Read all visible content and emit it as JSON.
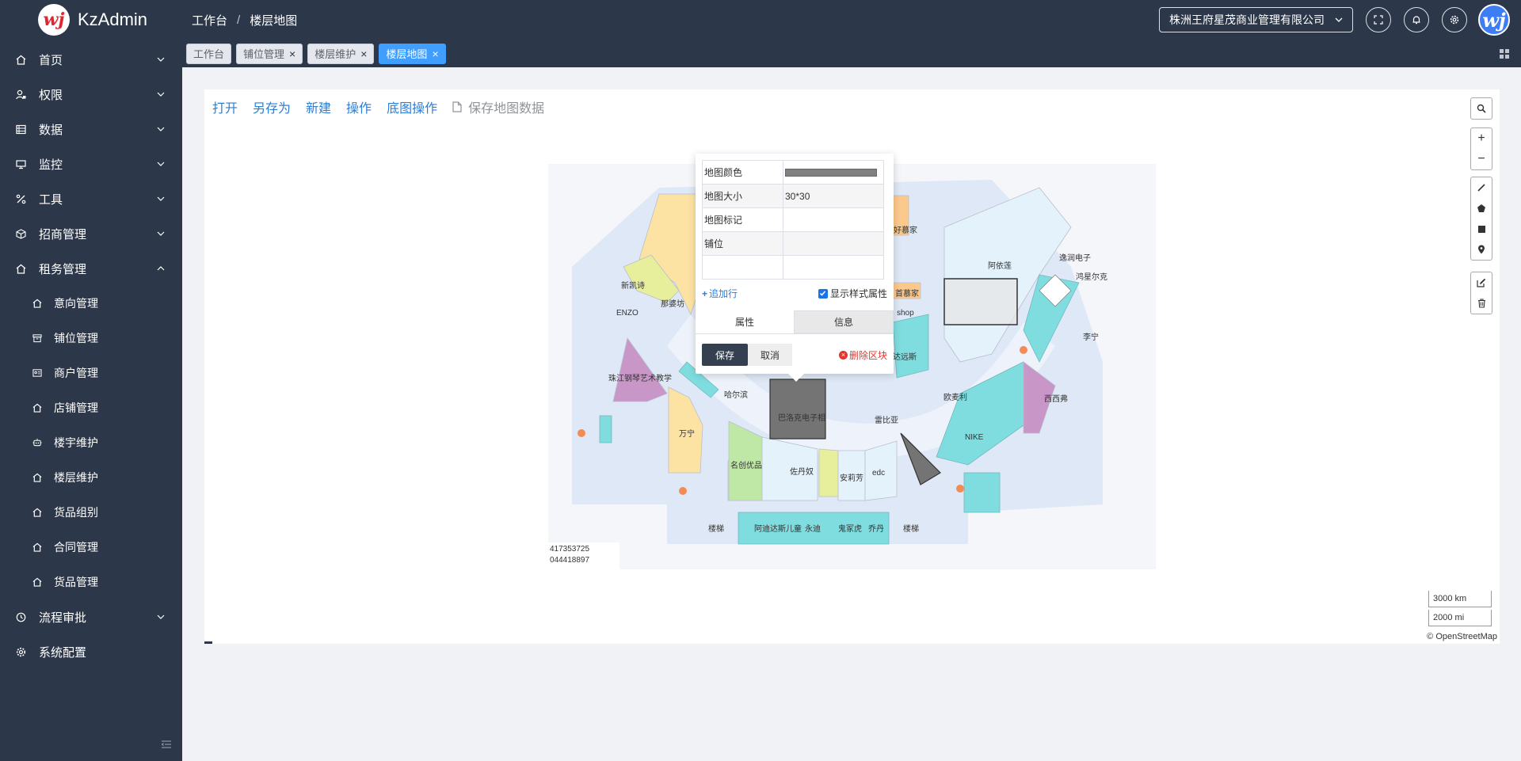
{
  "app": {
    "title": "KzAdmin",
    "logo_glyph": "wj"
  },
  "breadcrumb": [
    "工作台",
    "楼层地图"
  ],
  "header": {
    "company": "株洲王府星茂商业管理有限公司",
    "icons": [
      "fullscreen-icon",
      "bell-icon",
      "gear-icon"
    ]
  },
  "sidebar": {
    "items": [
      {
        "label": "首页",
        "icon": "home-icon",
        "expanded": false
      },
      {
        "label": "权限",
        "icon": "user-lock-icon",
        "expanded": false
      },
      {
        "label": "数据",
        "icon": "list-icon",
        "expanded": false
      },
      {
        "label": "监控",
        "icon": "monitor-icon",
        "expanded": false
      },
      {
        "label": "工具",
        "icon": "percent-icon",
        "expanded": false
      },
      {
        "label": "招商管理",
        "icon": "cube-icon",
        "expanded": false
      },
      {
        "label": "租务管理",
        "icon": "home-icon",
        "expanded": true
      }
    ],
    "sub_items": [
      "意向管理",
      "铺位管理",
      "商户管理",
      "店铺管理",
      "楼宇维护",
      "楼层维护",
      "货品组别",
      "合同管理",
      "货品管理"
    ],
    "bottom_items": [
      {
        "label": "流程审批",
        "icon": "clock-icon",
        "expanded": false
      },
      {
        "label": "系统配置",
        "icon": "gear-icon"
      }
    ]
  },
  "tabs": [
    {
      "label": "工作台",
      "closable": false,
      "active": false
    },
    {
      "label": "铺位管理",
      "closable": true,
      "active": false
    },
    {
      "label": "楼层维护",
      "closable": true,
      "active": false
    },
    {
      "label": "楼层地图",
      "closable": true,
      "active": true
    }
  ],
  "toolbar": {
    "items": [
      "打开",
      "另存为",
      "新建",
      "操作",
      "底图操作"
    ],
    "save_label": "保存地图数据"
  },
  "popup": {
    "rows": [
      {
        "key": "地图颜色",
        "value": "",
        "swatch": "#808080"
      },
      {
        "key": "地图大小",
        "value": "30*30"
      },
      {
        "key": "地图标记",
        "value": ""
      },
      {
        "key": "铺位",
        "value": ""
      },
      {
        "key": "",
        "value": ""
      }
    ],
    "add_row": "追加行",
    "show_style": "显示样式属性",
    "show_style_checked": true,
    "tabs": [
      "属性",
      "信息"
    ],
    "save": "保存",
    "cancel": "取消",
    "delete": "删除区块"
  },
  "map": {
    "labels": [
      "阿依莲",
      "逸润电子",
      "鸿星尔克",
      "李宁",
      "西西弗",
      "NIKE",
      "欧麦利",
      "雷比亚",
      "edc",
      "安莉芳",
      "佐丹奴",
      "名创优品",
      "万宁",
      "珠江钢琴艺术教学",
      "ENZO",
      "新凯诗",
      "那婆坊",
      "好慕家",
      "首慕家",
      "巴洛克电子相",
      "楼梯",
      "阿迪达斯儿童",
      "永迪",
      "鬼冢虎",
      "乔丹",
      "楼梯",
      "shop",
      "哈尔滨",
      "达远斯"
    ],
    "coords": [
      "417353725",
      "044418897"
    ],
    "scale_km": "3000 km",
    "scale_mi": "2000 mi",
    "attribution": "© OpenStreetMap"
  },
  "colors": {
    "sidebar_bg": "#2c3749",
    "link": "#2e7ed4",
    "active_tab": "#409eff",
    "danger": "#e2362f"
  }
}
